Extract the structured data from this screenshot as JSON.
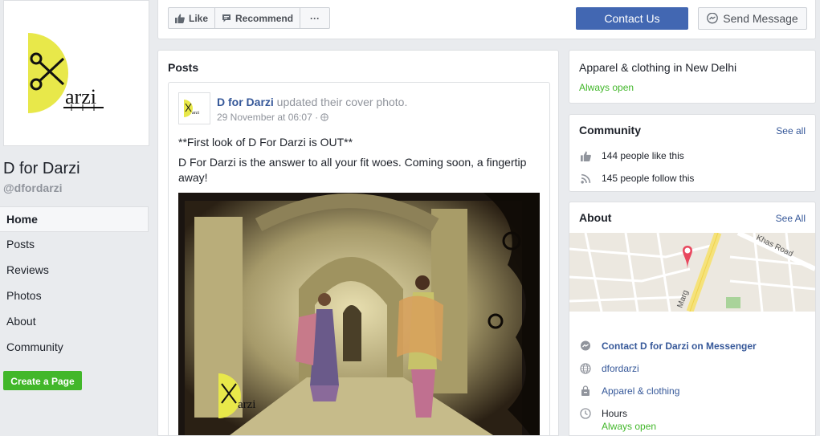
{
  "page": {
    "name": "D for Darzi",
    "handle": "@dfordarzi",
    "logo_text": "arzi",
    "logo_letter": "D"
  },
  "nav": {
    "items": [
      {
        "label": "Home",
        "active": true
      },
      {
        "label": "Posts"
      },
      {
        "label": "Reviews"
      },
      {
        "label": "Photos"
      },
      {
        "label": "About"
      },
      {
        "label": "Community"
      }
    ],
    "create_page": "Create a Page"
  },
  "actions": {
    "like": "Like",
    "recommend": "Recommend",
    "more": "···",
    "contact": "Contact Us",
    "send_message": "Send Message"
  },
  "posts": {
    "title": "Posts",
    "post": {
      "author": "D for Darzi",
      "action": " updated their cover photo.",
      "time": "29 November at 06:07 · ",
      "line1": "**First look of D For Darzi is OUT**",
      "line2": "D For Darzi is the answer to all your fit woes. Coming soon, a fingertip away!",
      "photo_logo_text": "arzi"
    }
  },
  "category": {
    "title": "Apparel & clothing in New Delhi",
    "status": "Always open"
  },
  "community": {
    "title": "Community",
    "see_all": "See all",
    "likes": "144 people like this",
    "follows": "145 people follow this"
  },
  "about": {
    "title": "About",
    "see_all": "See All",
    "map_road1": "Khas Road",
    "map_road2": "Marg",
    "messenger": "Contact D for Darzi on Messenger",
    "website": "dfordarzi",
    "category": "Apparel & clothing",
    "hours_label": "Hours",
    "hours_status": "Always open"
  },
  "colors": {
    "brand_blue": "#4267b2",
    "link": "#365899",
    "green": "#42b72a",
    "logo_yellow": "#e8e84a"
  }
}
